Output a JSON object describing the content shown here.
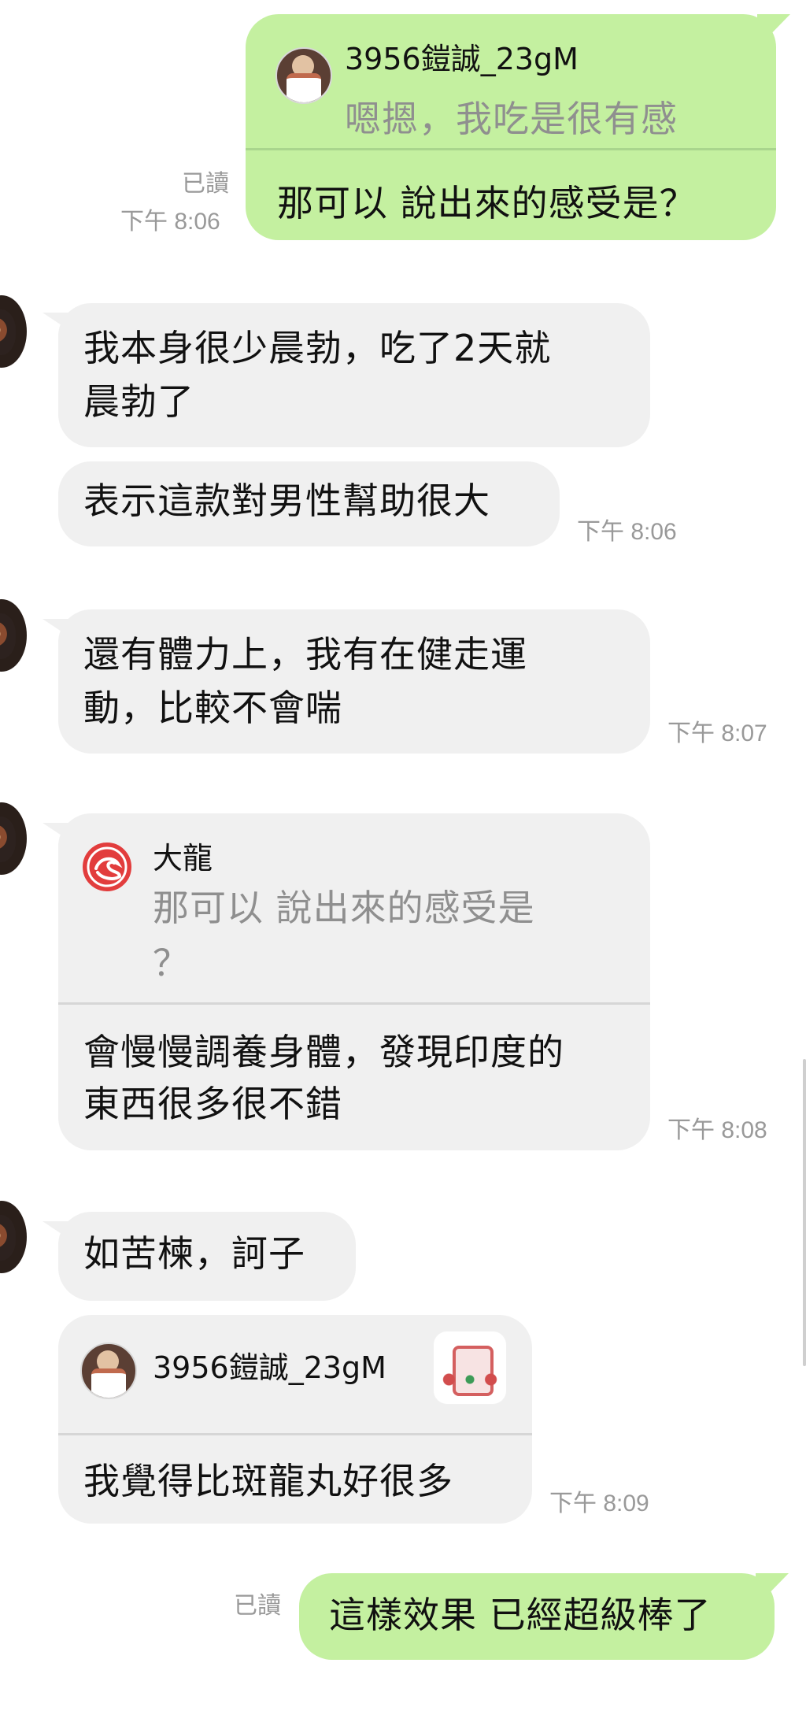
{
  "messages": {
    "m1": {
      "quote_name": "3956鎧誠_23gM",
      "quote_text": "嗯摁，我吃是很有感",
      "text": "那可以 說出來的感受是？",
      "read": "已讀",
      "time": "下午 8:06"
    },
    "m2": {
      "line1": "我本身很少晨勃，吃了2天就",
      "line2": "晨勃了"
    },
    "m3": {
      "text": "表示這款對男性幫助很大",
      "time": "下午 8:06"
    },
    "m4": {
      "line1": "還有體力上，我有在健走運",
      "line2": "動，比較不會喘",
      "time": "下午 8:07"
    },
    "m5": {
      "quote_name": "大龍",
      "quote_line1": "那可以 說出來的感受是",
      "quote_line2": "？",
      "line1": "會慢慢調養身體，發現印度的",
      "line2": "東西很多很不錯",
      "time": "下午 8:08"
    },
    "m6": {
      "text": "如苦楝，訶子"
    },
    "m7": {
      "quote_name": "3956鎧誠_23gM",
      "text": "我覺得比斑龍丸好很多",
      "time": "下午 8:09"
    },
    "m8": {
      "text": "這樣效果 已經超級棒了",
      "read": "已讀"
    }
  },
  "icons": {
    "m1_avatar": "user-avatar-icon",
    "left_avatar": "contact-avatar-icon",
    "m5_avatar": "dragon-logo-icon",
    "m7_avatar": "user-avatar-icon",
    "m7_thumb": "product-thumbnail-icon"
  },
  "colors": {
    "sent_bubble": "#c4f0a0",
    "received_bubble": "#f0f0f0",
    "meta_text": "#999999",
    "quote_text": "#8f8f8f"
  }
}
